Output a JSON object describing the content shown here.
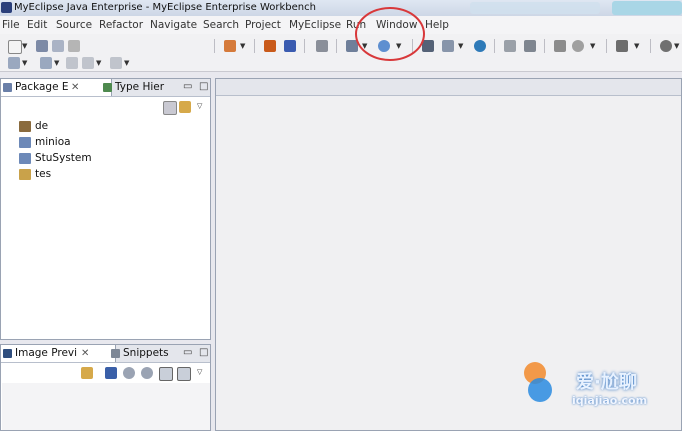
{
  "window": {
    "title": "MyEclipse Java Enterprise - MyEclipse Enterprise Workbench"
  },
  "menubar": {
    "items": [
      "File",
      "Edit",
      "Source",
      "Refactor",
      "Navigate",
      "Search",
      "Project",
      "MyEclipse",
      "Run",
      "Window",
      "Help"
    ]
  },
  "package_panel": {
    "tabs": [
      {
        "label": "Package E"
      },
      {
        "label": "Type Hier"
      }
    ],
    "tree": [
      {
        "label": "de",
        "icon": "project-icon"
      },
      {
        "label": "minioa",
        "icon": "folder-icon"
      },
      {
        "label": "StuSystem",
        "icon": "folder-icon"
      },
      {
        "label": "tes",
        "icon": "folder-open-icon"
      }
    ]
  },
  "image_panel": {
    "tabs": [
      {
        "label": "Image Previ"
      },
      {
        "label": "Snippets"
      }
    ]
  },
  "watermark": {
    "site": "iqiajiao.com",
    "brand": "爱·尬聊"
  },
  "colors": {
    "highlight_circle": "#d8383a",
    "panel_border": "#9aa3b3"
  }
}
